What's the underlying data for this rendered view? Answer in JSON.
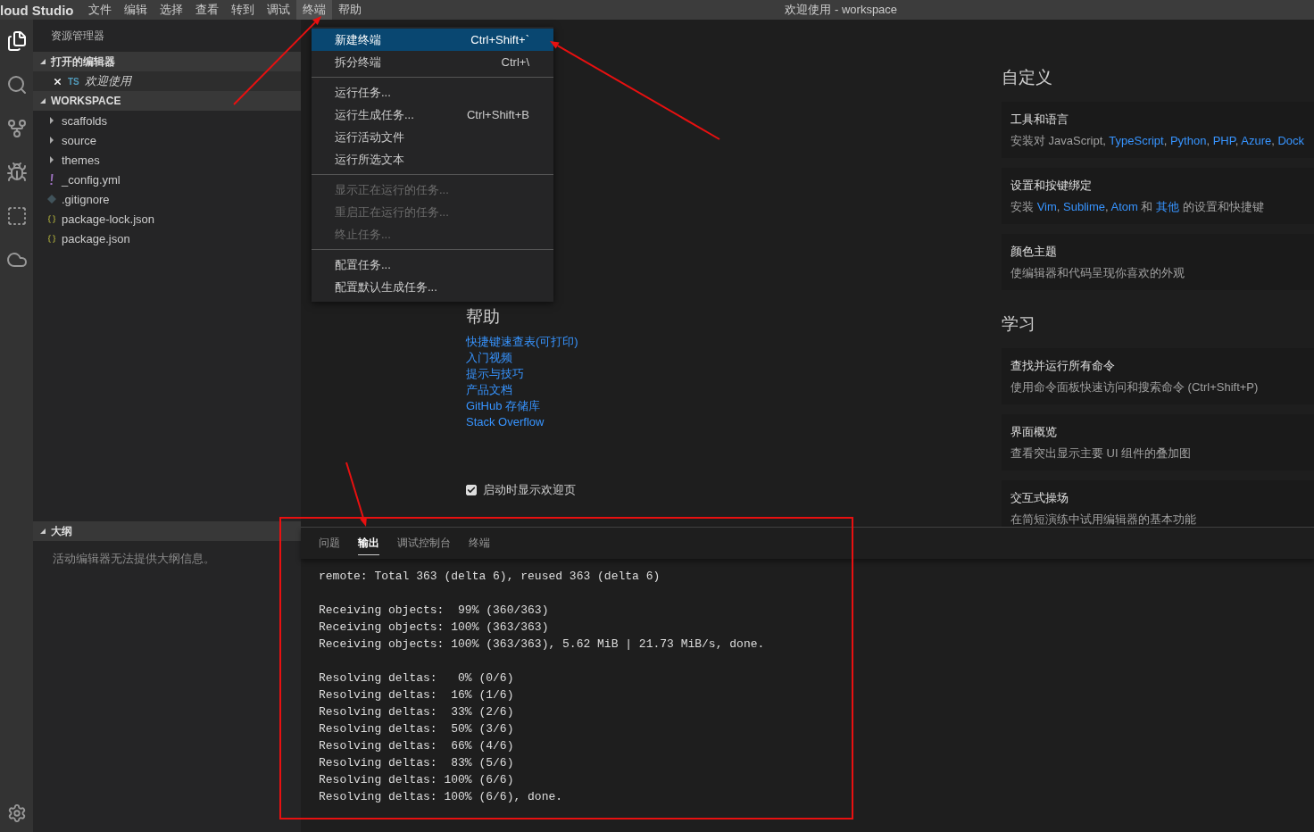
{
  "title_bar": {
    "app_name": "loud Studio",
    "menus": [
      {
        "label": "文件",
        "selected": false
      },
      {
        "label": "编辑",
        "selected": false
      },
      {
        "label": "选择",
        "selected": false
      },
      {
        "label": "查看",
        "selected": false
      },
      {
        "label": "转到",
        "selected": false
      },
      {
        "label": "调试",
        "selected": false
      },
      {
        "label": "终端",
        "selected": true
      },
      {
        "label": "帮助",
        "selected": false
      }
    ],
    "title": "欢迎使用 - workspace"
  },
  "sidebar": {
    "header": "资源管理器",
    "open_editors": {
      "title": "打开的编辑器",
      "expanded": true,
      "items": [
        {
          "badge": "TS",
          "label": "欢迎使用"
        }
      ]
    },
    "workspace": {
      "title": "WORKSPACE",
      "expanded": true,
      "items": [
        {
          "kind": "folder",
          "label": "scaffolds",
          "expanded": false
        },
        {
          "kind": "folder",
          "label": "source",
          "expanded": false
        },
        {
          "kind": "folder",
          "label": "themes",
          "expanded": false
        },
        {
          "kind": "yaml",
          "label": "_config.yml"
        },
        {
          "kind": "git",
          "label": ".gitignore"
        },
        {
          "kind": "json",
          "label": "package-lock.json"
        },
        {
          "kind": "json",
          "label": "package.json"
        }
      ]
    },
    "outline": {
      "title": "大纲",
      "expanded": true,
      "message": "活动编辑器无法提供大纲信息。"
    }
  },
  "menu": {
    "groups": [
      [
        {
          "label": "新建终端",
          "shortcut": "Ctrl+Shift+`",
          "selected": true,
          "disabled": false
        },
        {
          "label": "拆分终端",
          "shortcut": "Ctrl+\\",
          "selected": false,
          "disabled": false
        }
      ],
      [
        {
          "label": "运行任务...",
          "selected": false,
          "disabled": false
        },
        {
          "label": "运行生成任务...",
          "shortcut": "Ctrl+Shift+B",
          "selected": false,
          "disabled": false
        },
        {
          "label": "运行活动文件",
          "selected": false,
          "disabled": false
        },
        {
          "label": "运行所选文本",
          "selected": false,
          "disabled": false
        }
      ],
      [
        {
          "label": "显示正在运行的任务...",
          "selected": false,
          "disabled": true
        },
        {
          "label": "重启正在运行的任务...",
          "selected": false,
          "disabled": true
        },
        {
          "label": "终止任务...",
          "selected": false,
          "disabled": true
        }
      ],
      [
        {
          "label": "配置任务...",
          "selected": false,
          "disabled": false
        },
        {
          "label": "配置默认生成任务...",
          "selected": false,
          "disabled": false
        }
      ]
    ]
  },
  "welcome": {
    "help": {
      "title": "帮助",
      "links": [
        "快捷键速查表(可打印)",
        "入门视频",
        "提示与技巧",
        "产品文档",
        "GitHub 存储库",
        "Stack Overflow"
      ]
    },
    "show_on_startup": {
      "label": "启动时显示欢迎页",
      "checked": true
    },
    "sections": [
      {
        "title": "自定义",
        "cards": [
          {
            "title": "工具和语言",
            "description": [
              {
                "text": "安装对 JavaScript, "
              },
              {
                "text": "TypeScript",
                "link": true
              },
              {
                "text": ", "
              },
              {
                "text": "Python",
                "link": true
              },
              {
                "text": ", "
              },
              {
                "text": "PHP",
                "link": true
              },
              {
                "text": ", "
              },
              {
                "text": "Azure",
                "link": true
              },
              {
                "text": ", "
              },
              {
                "text": "Dock",
                "link": true
              }
            ]
          },
          {
            "title": "设置和按键绑定",
            "description": [
              {
                "text": "安装 "
              },
              {
                "text": "Vim",
                "link": true
              },
              {
                "text": ", "
              },
              {
                "text": "Sublime",
                "link": true
              },
              {
                "text": ", "
              },
              {
                "text": "Atom",
                "link": true
              },
              {
                "text": " 和 "
              },
              {
                "text": "其他",
                "link": true
              },
              {
                "text": " 的设置和快捷键"
              }
            ]
          },
          {
            "title": "颜色主题",
            "description": [
              {
                "text": "使编辑器和代码呈现你喜欢的外观"
              }
            ]
          }
        ]
      },
      {
        "title": "学习",
        "cards": [
          {
            "title": "查找并运行所有命令",
            "description": [
              {
                "text": "使用命令面板快速访问和搜索命令 (Ctrl+Shift+P)"
              }
            ]
          },
          {
            "title": "界面概览",
            "description": [
              {
                "text": "查看突出显示主要 UI 组件的叠加图"
              }
            ]
          },
          {
            "title": "交互式操场",
            "description": [
              {
                "text": "在简短演练中试用编辑器的基本功能"
              }
            ]
          }
        ]
      }
    ]
  },
  "panel": {
    "tabs": [
      {
        "label": "问题",
        "selected": false
      },
      {
        "label": "输出",
        "selected": true
      },
      {
        "label": "调试控制台",
        "selected": false
      },
      {
        "label": "终端",
        "selected": false
      }
    ],
    "output_blocks": [
      [
        "remote: Total 363 (delta 6), reused 363 (delta 6)"
      ],
      [
        "Receiving objects:  99% (360/363)",
        "Receiving objects: 100% (363/363)",
        "Receiving objects: 100% (363/363), 5.62 MiB | 21.73 MiB/s, done."
      ],
      [
        "Resolving deltas:   0% (0/6)",
        "Resolving deltas:  16% (1/6)",
        "Resolving deltas:  33% (2/6)",
        "Resolving deltas:  50% (3/6)",
        "Resolving deltas:  66% (4/6)",
        "Resolving deltas:  83% (5/6)",
        "Resolving deltas: 100% (6/6)",
        "Resolving deltas: 100% (6/6), done."
      ]
    ]
  }
}
